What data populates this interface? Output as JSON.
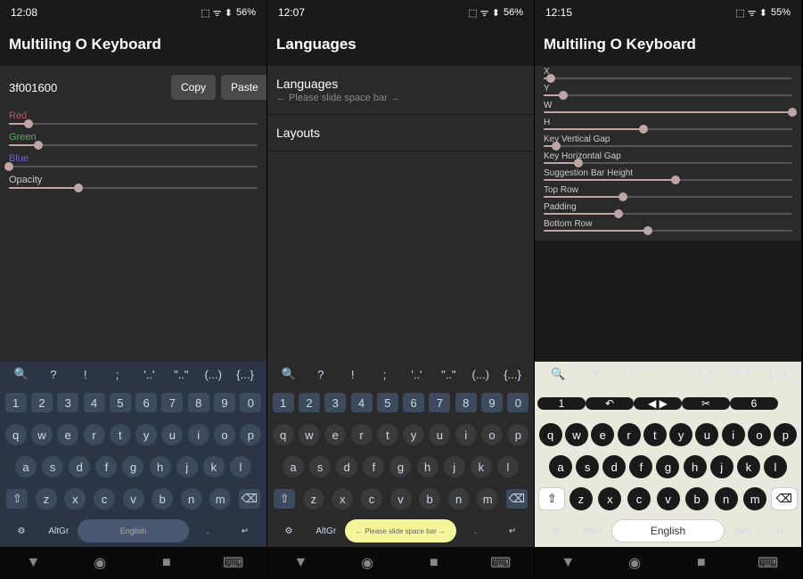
{
  "screen1": {
    "time": "12:08",
    "battery": "56%",
    "title": "Multiling O Keyboard",
    "hex": "3f001600",
    "copy": "Copy",
    "paste": "Paste",
    "sliders": [
      {
        "label": "Red",
        "cls": "lbl-red",
        "pct": 8
      },
      {
        "label": "Green",
        "cls": "lbl-green",
        "pct": 12
      },
      {
        "label": "Blue",
        "cls": "lbl-blue",
        "pct": 0
      },
      {
        "label": "Opacity",
        "cls": "lbl-white",
        "pct": 28
      }
    ],
    "kbd": {
      "sug": [
        "🔍",
        "?",
        "!",
        ";",
        "'..'",
        "\"..\"",
        "(...)",
        "{...}"
      ],
      "numrow": [
        "1",
        "2",
        "3",
        "4",
        "5",
        "6",
        "7",
        "8",
        "9",
        "0"
      ],
      "r1": [
        "q",
        "w",
        "e",
        "r",
        "t",
        "y",
        "u",
        "i",
        "o",
        "p"
      ],
      "r2": [
        "a",
        "s",
        "d",
        "f",
        "g",
        "h",
        "j",
        "k",
        "l"
      ],
      "r3": [
        "⇧",
        "z",
        "x",
        "c",
        "v",
        "b",
        "n",
        "m",
        "⌫"
      ],
      "r4": [
        "⚙",
        "AltGr",
        "English",
        ".",
        "↵"
      ]
    }
  },
  "screen2": {
    "time": "12:07",
    "battery": "56%",
    "title": "Languages",
    "items": [
      {
        "title": "Languages",
        "sub": "← Please slide space bar →"
      },
      {
        "title": "Layouts",
        "sub": ""
      }
    ],
    "kbd": {
      "sug": [
        "🔍",
        "?",
        "!",
        ";",
        "'..'",
        "\"..\"",
        "(...)",
        "{...}"
      ],
      "numrow": [
        "1",
        "2",
        "3",
        "4",
        "5",
        "6",
        "7",
        "8",
        "9",
        "0"
      ],
      "r1": [
        "q",
        "w",
        "e",
        "r",
        "t",
        "y",
        "u",
        "i",
        "o",
        "p"
      ],
      "r2": [
        "a",
        "s",
        "d",
        "f",
        "g",
        "h",
        "j",
        "k",
        "l"
      ],
      "r3": [
        "⇧",
        "z",
        "x",
        "c",
        "v",
        "b",
        "n",
        "m",
        "⌫"
      ],
      "r4": [
        "⚙",
        "AltGr",
        "← Please slide space bar →",
        ".",
        "↵"
      ]
    }
  },
  "screen3": {
    "time": "12:15",
    "battery": "55%",
    "title": "Multiling O Keyboard",
    "sliders": [
      {
        "label": "X",
        "pct": 3
      },
      {
        "label": "Y",
        "pct": 8
      },
      {
        "label": "W",
        "pct": 100
      },
      {
        "label": "H",
        "pct": 40
      },
      {
        "label": "Key Vertical Gap",
        "pct": 5
      },
      {
        "label": "Key Horizontal Gap",
        "pct": 14
      },
      {
        "label": "Suggestion Bar Height",
        "pct": 53
      },
      {
        "label": "Top Row",
        "pct": 32
      },
      {
        "label": "Padding",
        "pct": 30
      },
      {
        "label": "Bottom Row",
        "pct": 42
      }
    ],
    "kbd": {
      "sug": [
        "🔍",
        "?",
        "!",
        ";",
        "'..'",
        "\"..\"",
        "(...)"
      ],
      "toprow": [
        "1",
        "↶",
        "◀ ▶",
        "✂",
        "6",
        " "
      ],
      "r1": [
        "q",
        "w",
        "e",
        "r",
        "t",
        "y",
        "u",
        "i",
        "o",
        "p"
      ],
      "r2": [
        "a",
        "s",
        "d",
        "f",
        "g",
        "h",
        "j",
        "k",
        "l"
      ],
      "r3": [
        "⇧",
        "z",
        "x",
        "c",
        "v",
        "b",
        "n",
        "m",
        "⌫"
      ],
      "r4": [
        "⚙",
        "AltGr",
        "English",
        "Sym",
        "↵"
      ]
    }
  },
  "statusicons": "⬚ ᯤ ⬍"
}
